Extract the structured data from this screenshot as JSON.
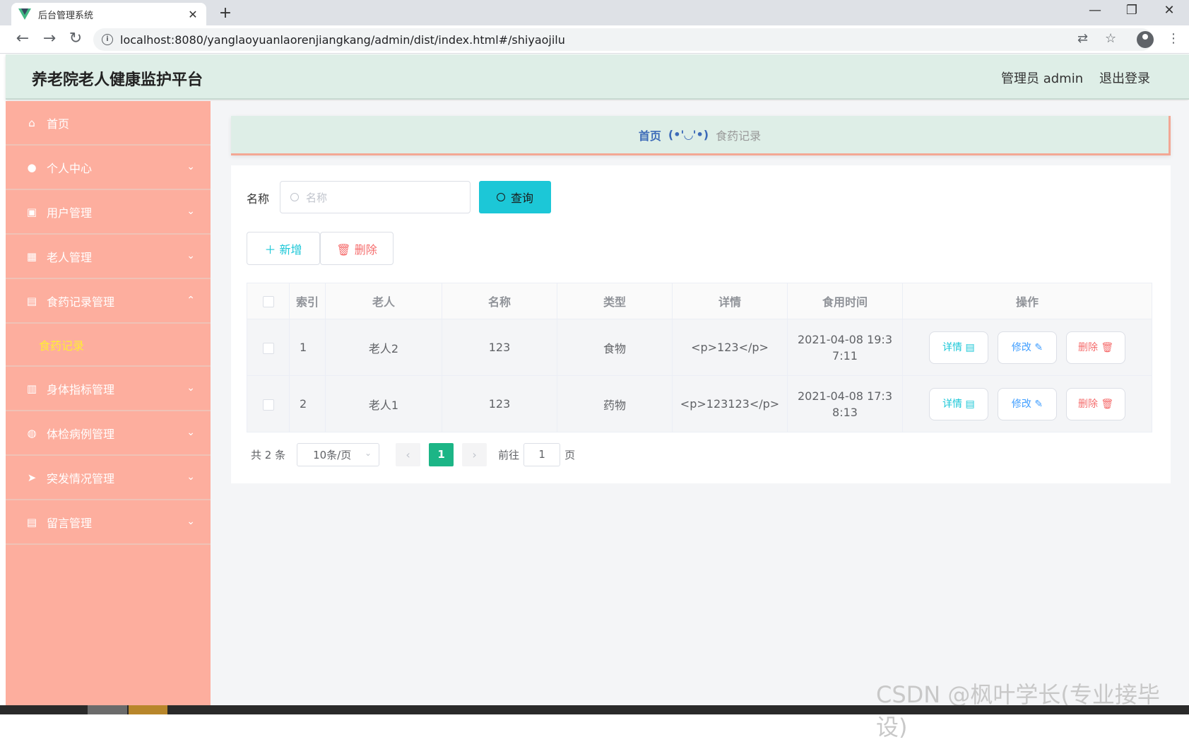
{
  "browser": {
    "tab_title": "后台管理系统",
    "tab_close": "✕",
    "new_tab": "+",
    "url": "localhost:8080/yanglaoyuanlaorenjiangkang/admin/dist/index.html#/shiyaojilu",
    "win_minimize": "—",
    "win_restore": "❐",
    "win_close": "✕",
    "back": "←",
    "forward": "→",
    "reload": "↻",
    "translate": "⇄",
    "star": "☆",
    "more": "⋮"
  },
  "header": {
    "title": "养老院老人健康监护平台",
    "user": "管理员 admin",
    "logout": "退出登录"
  },
  "sidebar": {
    "items": [
      {
        "label": "首页",
        "icon": "home-icon",
        "glyph": "⌂",
        "chevron": ""
      },
      {
        "label": "个人中心",
        "icon": "user-icon",
        "glyph": "●",
        "chevron": "⌄"
      },
      {
        "label": "用户管理",
        "icon": "clipboard-icon",
        "glyph": "▣",
        "chevron": "⌄"
      },
      {
        "label": "老人管理",
        "icon": "grid-icon",
        "glyph": "▦",
        "chevron": "⌄"
      },
      {
        "label": "食药记录管理",
        "icon": "briefcase-icon",
        "glyph": "▤",
        "chevron": "⌃"
      },
      {
        "label": "身体指标管理",
        "icon": "table-icon",
        "glyph": "▥",
        "chevron": "⌄"
      },
      {
        "label": "体检病例管理",
        "icon": "globe-icon",
        "glyph": "◍",
        "chevron": "⌄"
      },
      {
        "label": "突发情况管理",
        "icon": "send-icon",
        "glyph": "➤",
        "chevron": "⌄"
      },
      {
        "label": "留言管理",
        "icon": "note-icon",
        "glyph": "▤",
        "chevron": "⌄"
      }
    ],
    "sub_item": "食药记录"
  },
  "breadcrumb": {
    "home": "首页",
    "sep": "(•'◡'•)",
    "current": "食药记录"
  },
  "search": {
    "label": "名称",
    "placeholder": "名称",
    "button": "查询"
  },
  "actions": {
    "add": "＋ 新增",
    "delete": "🗑 删除"
  },
  "table": {
    "headers": [
      "索引",
      "老人",
      "名称",
      "类型",
      "详情",
      "食用时间",
      "操作"
    ],
    "rows": [
      {
        "index": "1",
        "elder": "老人2",
        "name": "123",
        "type": "食物",
        "detail": "<p>123</p>",
        "time_a": "2021-04-08 19:3",
        "time_b": "7:11"
      },
      {
        "index": "2",
        "elder": "老人1",
        "name": "123",
        "type": "药物",
        "detail": "<p>123123</p>",
        "time_a": "2021-04-08 17:3",
        "time_b": "8:13"
      }
    ],
    "op_detail": "详情 ▤",
    "op_edit": "修改 ✎",
    "op_delete": "删除 🗑"
  },
  "pagination": {
    "total": "共 2 条",
    "page_size": "10条/页",
    "prev": "‹",
    "current": "1",
    "next": "›",
    "goto": "前往",
    "goto_value": "1",
    "page_unit": "页"
  },
  "watermark": "CSDN @枫叶学长(专业接毕设)",
  "colors": {
    "sidebar_bg": "#fdae9e",
    "header_bg": "#deeee7",
    "accent": "#1cc7d7",
    "active_page": "#1cb586",
    "submenu_active": "#ffee33"
  }
}
